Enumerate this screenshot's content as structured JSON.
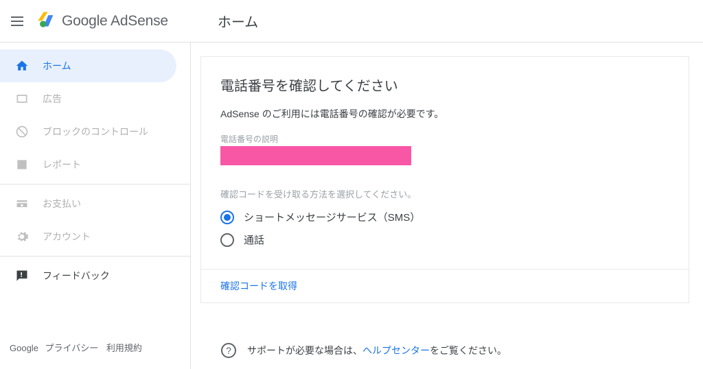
{
  "header": {
    "logo_google": "Google",
    "logo_adsense": "AdSense",
    "page_title": "ホーム"
  },
  "sidebar": {
    "items": [
      {
        "label": "ホーム"
      },
      {
        "label": "広告"
      },
      {
        "label": "ブロックのコントロール"
      },
      {
        "label": "レポート"
      },
      {
        "label": "お支払い"
      },
      {
        "label": "アカウント"
      },
      {
        "label": "フィードバック"
      }
    ]
  },
  "footer": {
    "google": "Google",
    "privacy": "プライバシー",
    "terms": "利用規約"
  },
  "card": {
    "title": "電話番号を確認してください",
    "description": "AdSense のご利用には電話番号の確認が必要です。",
    "phone_label": "電話番号の説明",
    "method_label": "確認コードを受け取る方法を選択してください。",
    "options": {
      "sms": "ショートメッセージサービス（SMS）",
      "call": "通話"
    },
    "action": "確認コードを取得"
  },
  "support": {
    "prefix": "サポートが必要な場合は、",
    "link": "ヘルプセンター",
    "suffix": "をご覧ください。"
  }
}
